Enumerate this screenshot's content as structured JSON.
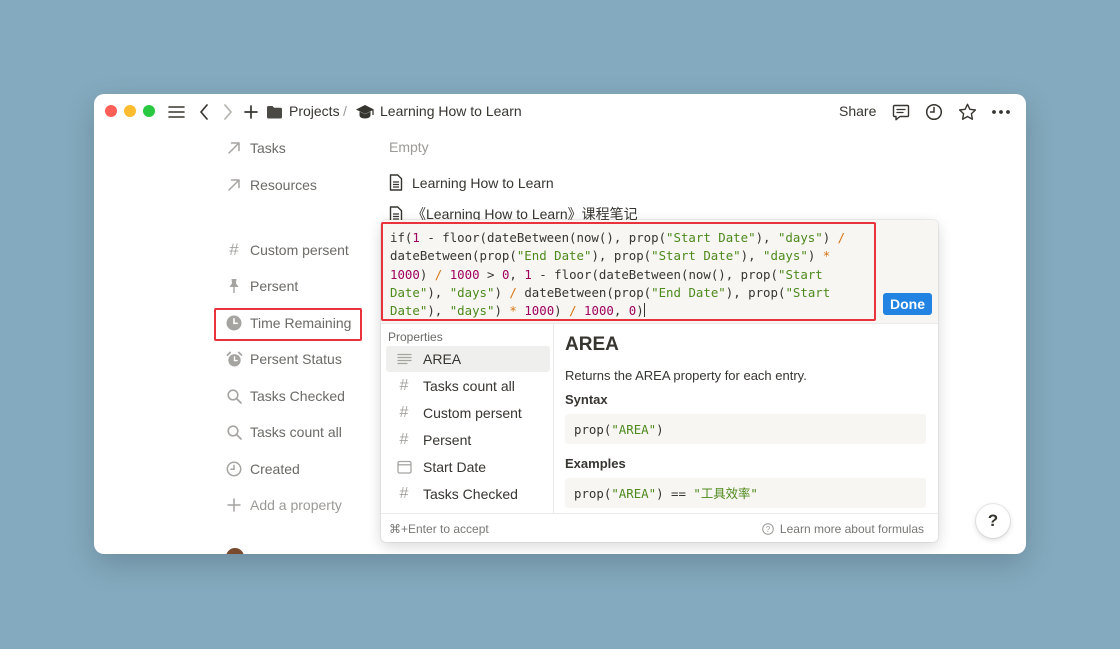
{
  "breadcrumb": {
    "parent": "Projects",
    "separator": "/",
    "current": "Learning How to Learn"
  },
  "topbar": {
    "share_label": "Share"
  },
  "properties": {
    "tasks": "Tasks",
    "resources": "Resources",
    "custom_persent": "Custom persent",
    "persent": "Persent",
    "time_remaining": "Time Remaining",
    "persent_status": "Persent Status",
    "tasks_checked": "Tasks Checked",
    "tasks_count_all": "Tasks count all",
    "created": "Created",
    "add_property": "Add a property"
  },
  "values": {
    "tasks_empty": "Empty",
    "resource_1": "Learning How to Learn",
    "resource_2": "《Learning How to Learn》课程笔记"
  },
  "formula_popup": {
    "done_label": "Done",
    "section_label": "Properties",
    "items": [
      "AREA",
      "Tasks count all",
      "Custom persent",
      "Persent",
      "Start Date",
      "Tasks Checked"
    ],
    "detail": {
      "title": "AREA",
      "description": "Returns the AREA property for each entry.",
      "syntax_heading": "Syntax",
      "syntax_code_fn": "prop(",
      "syntax_code_arg": "\"AREA\"",
      "syntax_code_end": ")",
      "examples_heading": "Examples",
      "example_fn": "prop(",
      "example_arg": "\"AREA\"",
      "example_mid": ") == ",
      "example_value": "\"工具效率\""
    },
    "footer_hint": "⌘+Enter to accept",
    "footer_link": "Learn more about formulas"
  },
  "help_label": "?",
  "colors": {
    "accent": "#2383e2",
    "highlight_box": "#e8323c",
    "string": "#4d8a1b",
    "number": "#a0005e",
    "operator": "#d9730d",
    "background": "#84aabf"
  }
}
